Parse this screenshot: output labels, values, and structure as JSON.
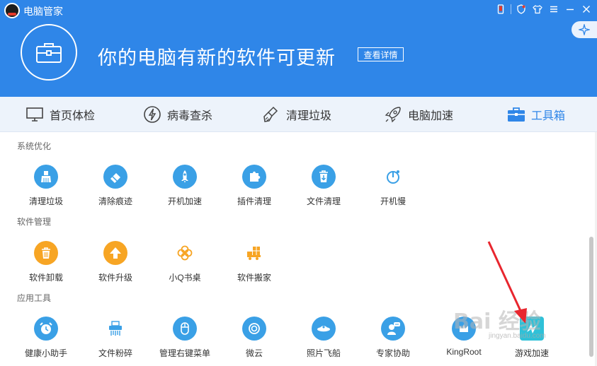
{
  "app": {
    "title": "电脑管家"
  },
  "hero": {
    "message": "你的电脑有新的软件可更新",
    "detail_button": "查看详情"
  },
  "nav": {
    "items": [
      {
        "label": "首页体检",
        "icon": "monitor-icon"
      },
      {
        "label": "病毒查杀",
        "icon": "lightning-icon"
      },
      {
        "label": "清理垃圾",
        "icon": "broom-icon"
      },
      {
        "label": "电脑加速",
        "icon": "rocket-icon"
      },
      {
        "label": "工具箱",
        "icon": "toolbox-icon",
        "active": true
      }
    ]
  },
  "sections": [
    {
      "title": "系统优化",
      "tools": [
        {
          "label": "清理垃圾",
          "icon": "broom-icon"
        },
        {
          "label": "清除痕迹",
          "icon": "eraser-icon"
        },
        {
          "label": "开机加速",
          "icon": "rocket-icon"
        },
        {
          "label": "插件清理",
          "icon": "puzzle-icon"
        },
        {
          "label": "文件清理",
          "icon": "trash-download-icon"
        },
        {
          "label": "开机慢",
          "icon": "power-icon"
        }
      ]
    },
    {
      "title": "软件管理",
      "tools": [
        {
          "label": "软件卸载",
          "icon": "trash-icon"
        },
        {
          "label": "软件升级",
          "icon": "up-arrow-icon"
        },
        {
          "label": "小Q书桌",
          "icon": "clover-icon"
        },
        {
          "label": "软件搬家",
          "icon": "truck-icon"
        }
      ]
    },
    {
      "title": "应用工具",
      "tools": [
        {
          "label": "健康小助手",
          "icon": "alarm-clock-icon"
        },
        {
          "label": "文件粉碎",
          "icon": "shredder-icon"
        },
        {
          "label": "管理右键菜单",
          "icon": "mouse-icon"
        },
        {
          "label": "微云",
          "icon": "cloud-icon"
        },
        {
          "label": "照片飞船",
          "icon": "ufo-icon"
        },
        {
          "label": "专家协助",
          "icon": "expert-chat-icon"
        },
        {
          "label": "KingRoot",
          "icon": "kingroot-icon"
        },
        {
          "label": "游戏加速",
          "icon": "game-boost-icon"
        }
      ]
    }
  ],
  "watermark": {
    "brand": "Bai 经验",
    "url": "jingyan.baidu.com"
  },
  "colors": {
    "header": "#2f86e8",
    "accent": "#2f86e8",
    "tool_blue": "#3aa0e6",
    "tool_orange": "#f7a524",
    "arrow": "#e8262e"
  }
}
